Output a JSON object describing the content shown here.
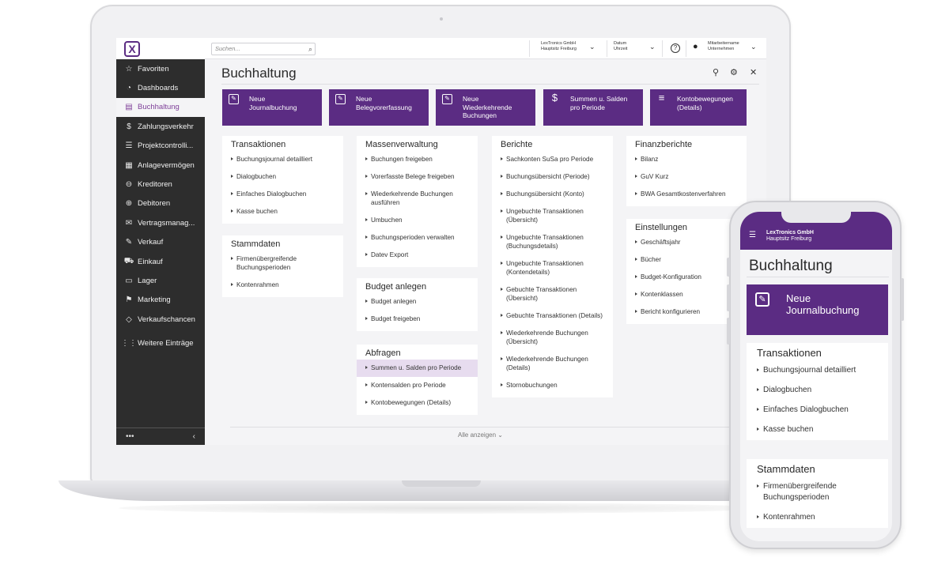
{
  "topbar": {
    "search_placeholder": "Suchen...",
    "company_name": "LexTronics GmbH",
    "company_sub": "Hauptsitz Freiburg",
    "date_label": "Datum",
    "time_label": "Uhrzeit",
    "help_symbol": "?",
    "user_name": "Mitarbeitername",
    "user_company": "Unternehmen"
  },
  "sidebar": {
    "logo_text": "X",
    "items": [
      {
        "label": "Favoriten",
        "icon": "☆"
      },
      {
        "label": "Dashboards",
        "icon": "◔"
      },
      {
        "label": "Buchhaltung",
        "icon": "▤"
      },
      {
        "label": "Zahlungsverkehr",
        "icon": "$"
      },
      {
        "label": "Projektcontrolli...",
        "icon": "☰"
      },
      {
        "label": "Anlagevermögen",
        "icon": "▦"
      },
      {
        "label": "Kreditoren",
        "icon": "⊖"
      },
      {
        "label": "Debitoren",
        "icon": "⊕"
      },
      {
        "label": "Vertragsmanag...",
        "icon": "✉"
      },
      {
        "label": "Verkauf",
        "icon": "✎"
      },
      {
        "label": "Einkauf",
        "icon": "⛟"
      },
      {
        "label": "Lager",
        "icon": "▭"
      },
      {
        "label": "Marketing",
        "icon": "⚑"
      },
      {
        "label": "Verkaufschancen",
        "icon": "◇"
      }
    ],
    "more_label": "Weitere Einträge",
    "more_icon": "⋮⋮",
    "footer_dots": "•••",
    "footer_chevron": "‹"
  },
  "page": {
    "title": "Buchhaltung",
    "show_all": "Alle anzeigen"
  },
  "tiles": [
    {
      "line1": "Neue",
      "line2": "Journalbuchung",
      "line3": "",
      "icon": "✎"
    },
    {
      "line1": "Neue",
      "line2": "Belegvorerfassung",
      "line3": "",
      "icon": "✎"
    },
    {
      "line1": "Neue",
      "line2": "Wiederkehrende",
      "line3": "Buchungen",
      "icon": "✎"
    },
    {
      "line1": "Summen u. Salden",
      "line2": "pro Periode",
      "line3": "",
      "icon": "$"
    },
    {
      "line1": "Kontobewegungen",
      "line2": "(Details)",
      "line3": "",
      "icon": "≡"
    }
  ],
  "cards": {
    "transaktionen": {
      "title": "Transaktionen",
      "items": [
        "Buchungsjournal detailliert",
        "Dialogbuchen",
        "Einfaches Dialogbuchen",
        "Kasse buchen"
      ]
    },
    "stammdaten": {
      "title": "Stammdaten",
      "items": [
        "Firmenübergreifende Buchungsperioden",
        "Kontenrahmen"
      ]
    },
    "massenverwaltung": {
      "title": "Massenverwaltung",
      "items": [
        "Buchungen freigeben",
        "Vorerfasste Belege freigeben",
        "Wiederkehrende Buchungen ausführen",
        "Umbuchen",
        "Buchungsperioden verwalten",
        "Datev Export"
      ]
    },
    "budget": {
      "title": "Budget anlegen",
      "items": [
        "Budget anlegen",
        "Budget freigeben"
      ]
    },
    "abfragen": {
      "title": "Abfragen",
      "items": [
        "Summen u. Salden pro Periode",
        "Kontensalden pro Periode",
        "Kontobewegungen (Details)"
      ]
    },
    "berichte": {
      "title": "Berichte",
      "items": [
        "Sachkonten SuSa pro Periode",
        "Buchungsübersicht (Periode)",
        "Buchungsübersicht (Konto)",
        "Ungebuchte Transaktionen (Übersicht)",
        "Ungebuchte Transaktionen (Buchungsdetails)",
        "Ungebuchte Transaktionen (Kontendetails)",
        "Gebuchte Transaktionen (Übersicht)",
        "Gebuchte Transaktionen (Details)",
        "Wiederkehrende Buchungen (Übersicht)",
        "Wiederkehrende Buchungen (Details)",
        "Stornobuchungen"
      ]
    },
    "finanzberichte": {
      "title": "Finanzberichte",
      "items": [
        "Bilanz",
        "GuV Kurz",
        "BWA Gesamtkostenverfahren"
      ]
    },
    "einstellungen": {
      "title": "Einstellungen",
      "items": [
        "Geschäftsjahr",
        "Bücher",
        "Budget-Konfiguration",
        "Kontenklassen",
        "Bericht konfigurieren"
      ]
    }
  },
  "phone": {
    "company_name": "LexTronics GmbH",
    "company_sub": "Hauptsitz Freiburg",
    "title": "Buchhaltung",
    "tile_line1": "Neue",
    "tile_line2": "Journalbuchung",
    "card1_title": "Transaktionen",
    "card1_items": [
      "Buchungsjournal detailliert",
      "Dialogbuchen",
      "Einfaches Dialogbuchen",
      "Kasse buchen"
    ],
    "card2_title": "Stammdaten",
    "card2_items": [
      "Firmenübergreifende Buchungsperioden",
      "Kontenrahmen"
    ]
  },
  "colors": {
    "accent": "#5b2c83",
    "sidebar_bg": "#2d2d2d",
    "highlight": "#e7dcef"
  }
}
